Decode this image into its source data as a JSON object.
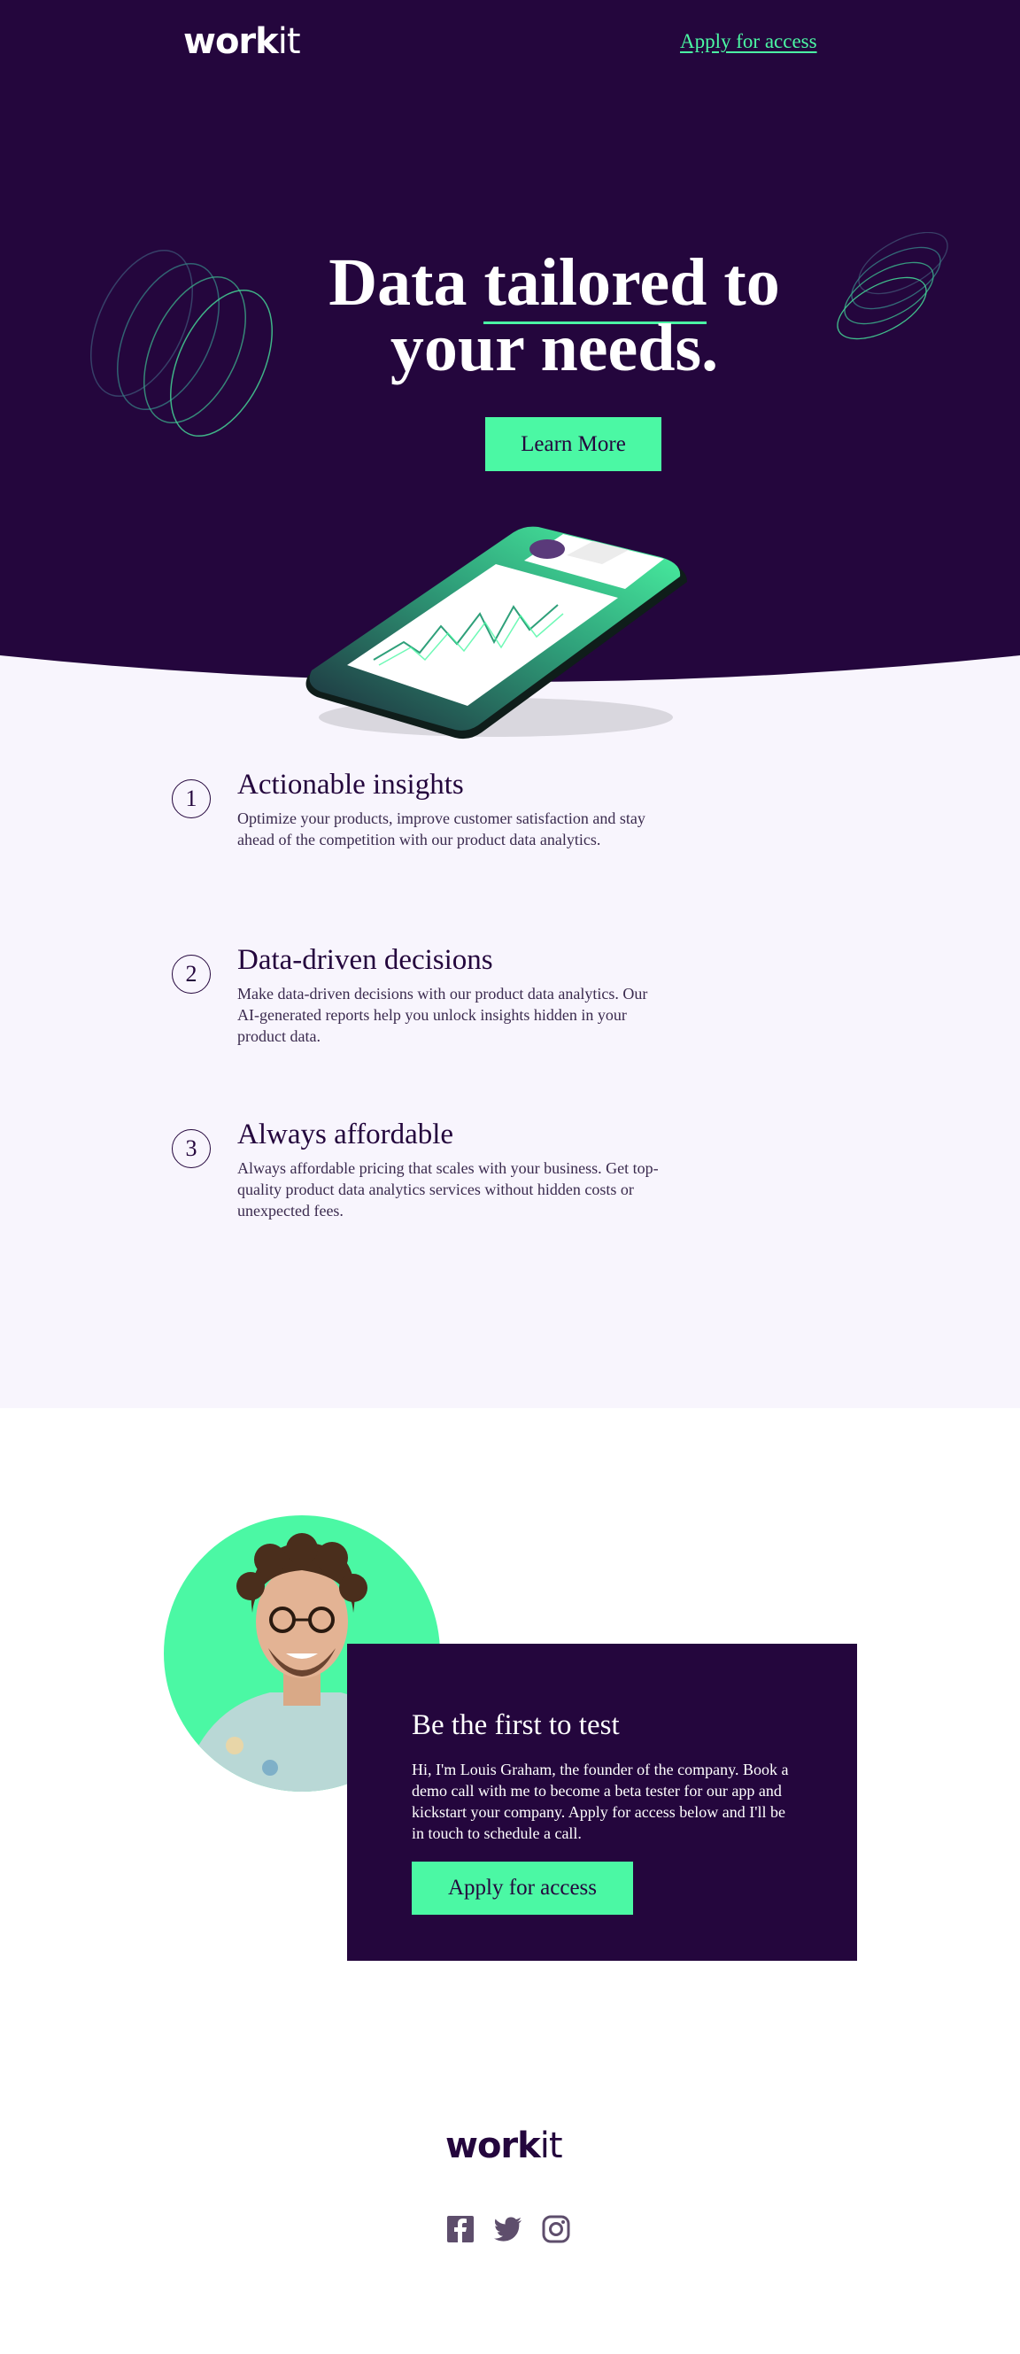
{
  "brand": {
    "logo_bold": "work",
    "logo_light": "it"
  },
  "nav": {
    "apply_link": "Apply for access"
  },
  "hero": {
    "headline_pre": "Data ",
    "headline_underlined": "tailored",
    "headline_post": " to your needs.",
    "cta_label": "Learn More"
  },
  "features": [
    {
      "number": "1",
      "title": "Actionable insights",
      "description": "Optimize your products, improve customer satisfaction and stay ahead of the competition with our product data analytics."
    },
    {
      "number": "2",
      "title": "Data-driven decisions",
      "description": "Make data-driven decisions with our product data analytics. Our AI-generated reports help you unlock insights hidden in your product data."
    },
    {
      "number": "3",
      "title": "Always affordable",
      "description": "Always affordable pricing that scales with your business. Get top-quality product data analytics services without hidden costs or unexpected fees."
    }
  ],
  "cta_card": {
    "title": "Be the first to test",
    "description": "Hi, I'm Louis Graham, the founder of the company. Book a demo call with me to become a beta tester for our app and kickstart your company. Apply for access below and I'll be in touch to schedule a call.",
    "button_label": "Apply for access"
  },
  "footer": {
    "social_icons": [
      "facebook-icon",
      "twitter-icon",
      "instagram-icon"
    ]
  },
  "colors": {
    "dark_purple": "#24063d",
    "accent_green": "#4bf8a4",
    "light_lavender": "#f8f5fd"
  }
}
